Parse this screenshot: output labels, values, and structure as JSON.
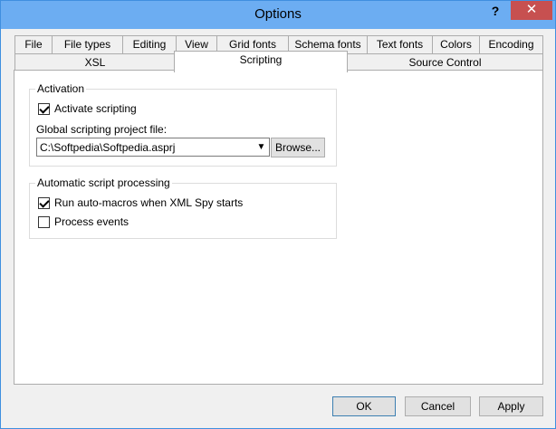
{
  "window": {
    "title": "Options",
    "help_glyph": "?",
    "close_glyph": "✕"
  },
  "tabs_row1": [
    "File",
    "File types",
    "Editing",
    "View",
    "Grid fonts",
    "Schema fonts",
    "Text fonts",
    "Colors",
    "Encoding"
  ],
  "tabs_row2": [
    "XSL",
    "Scripting",
    "Source Control"
  ],
  "activation": {
    "title": "Activation",
    "activate_label": "Activate scripting",
    "activate_checked": true,
    "project_file_label": "Global scripting project file:",
    "project_file_value": "C:\\Softpedia\\Softpedia.asprj",
    "browse_label": "Browse..."
  },
  "auto": {
    "title": "Automatic script processing",
    "run_macros_label": "Run auto-macros when XML Spy starts",
    "run_macros_checked": true,
    "process_events_label": "Process events",
    "process_events_checked": false
  },
  "buttons": {
    "ok": "OK",
    "cancel": "Cancel",
    "apply": "Apply"
  },
  "colors": {
    "titlebar": "#6cadf2",
    "close": "#c75050"
  }
}
